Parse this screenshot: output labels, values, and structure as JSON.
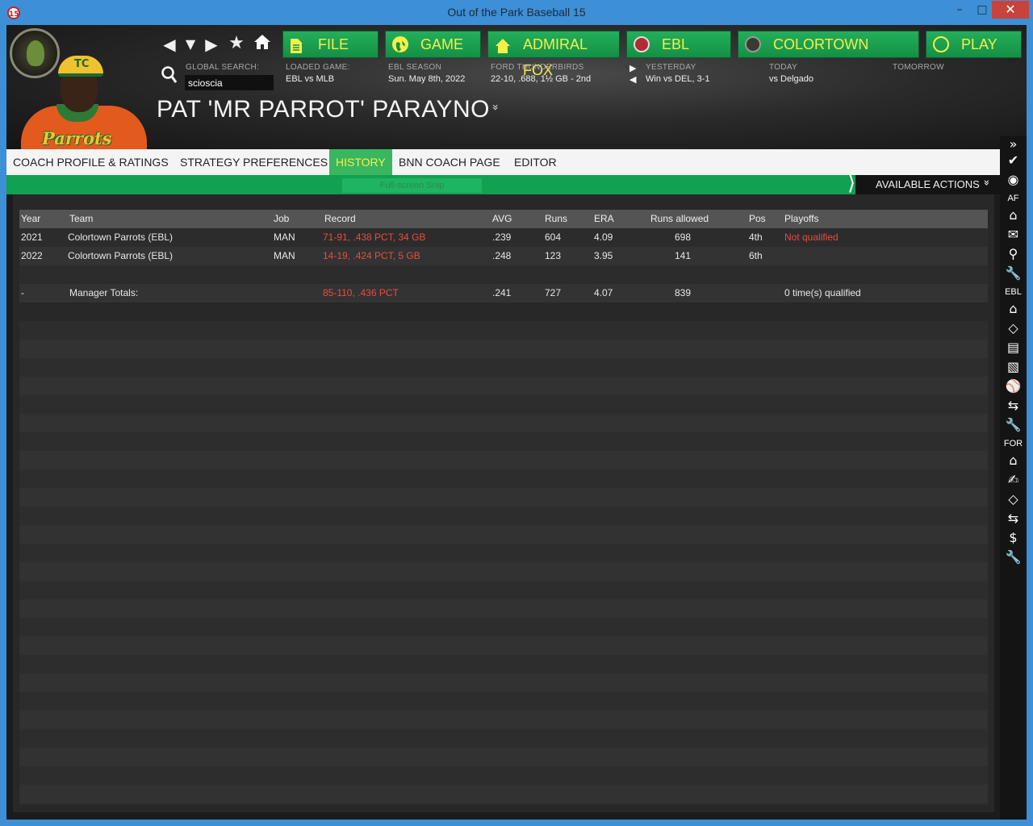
{
  "window": {
    "title": "Out of the Park Baseball 15",
    "icon_text": "15",
    "minimize": "–",
    "maximize": "□",
    "close": "✕"
  },
  "portrait": {
    "jersey_text": "Parrots",
    "cap_logo": "TC"
  },
  "nav": {
    "back": "◀",
    "history": "▼",
    "forward": "▶",
    "star": "★",
    "home": "⌂"
  },
  "top_buttons": {
    "file": "FILE",
    "game": "GAME",
    "admiral": "ADMIRAL FOX",
    "ebl": "EBL",
    "colortown": "COLORTOWN",
    "play": "PLAY"
  },
  "search": {
    "label": "GLOBAL SEARCH:",
    "value": "scioscia"
  },
  "info": {
    "loaded_game_label": "LOADED GAME:",
    "loaded_game_value": "EBL vs MLB",
    "season_label": "EBL SEASON",
    "season_value": "Sun. May 8th, 2022",
    "team_label": "FORD THUNDERBIRDS",
    "team_value": "22-10, .688, 1½ GB - 2nd",
    "yesterday_label": "YESTERDAY",
    "yesterday_value": "Win vs DEL, 3-1",
    "today_label": "TODAY",
    "today_value": "vs Delgado",
    "tomorrow_label": "TOMORROW"
  },
  "page_title": "PAT 'MR PARROT' PARAYNO",
  "tabs": [
    {
      "label": "COACH PROFILE & RATINGS"
    },
    {
      "label": "STRATEGY PREFERENCES"
    },
    {
      "label": "HISTORY"
    },
    {
      "label": "BNN COACH PAGE"
    },
    {
      "label": "EDITOR"
    }
  ],
  "snip_tooltip": "Full-screen Snip",
  "actions_label": "AVAILABLE ACTIONS",
  "table": {
    "headers": {
      "year": "Year",
      "team": "Team",
      "job": "Job",
      "record": "Record",
      "avg": "AVG",
      "runs": "Runs",
      "era": "ERA",
      "runs_allowed": "Runs allowed",
      "pos": "Pos",
      "playoffs": "Playoffs"
    },
    "rows": [
      {
        "year": "2021",
        "team": "Colortown Parrots (EBL)",
        "job": "MAN",
        "record": "71-91, .438 PCT, 34 GB",
        "avg": ".239",
        "runs": "604",
        "era": "4.09",
        "runs_allowed": "698",
        "pos": "4th",
        "playoffs": "Not qualified"
      },
      {
        "year": "2022",
        "team": "Colortown Parrots (EBL)",
        "job": "MAN",
        "record": "14-19, .424 PCT, 5 GB",
        "avg": ".248",
        "runs": "123",
        "era": "3.95",
        "runs_allowed": "141",
        "pos": "6th",
        "playoffs": ""
      }
    ],
    "totals": {
      "year": "-",
      "label": "Manager Totals:",
      "record": "85-110, .436 PCT",
      "avg": ".241",
      "runs": "727",
      "era": "4.07",
      "runs_allowed": "839",
      "playoffs": "0 time(s) qualified"
    }
  },
  "sidebar": {
    "expand": "»",
    "groups": [
      {
        "label": "AF"
      },
      {
        "label": "EBL"
      },
      {
        "label": "FOR"
      }
    ]
  }
}
